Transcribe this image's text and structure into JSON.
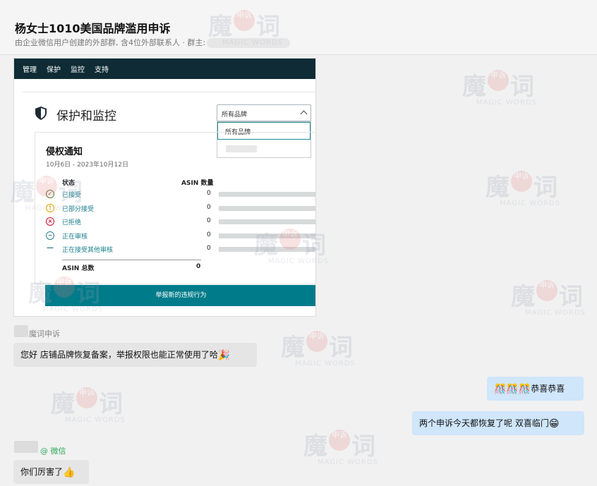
{
  "chat": {
    "title": "杨女士1010美国品牌滥用申诉",
    "subtitle": "由企业微信用户创建的外部群, 含4位外部联系人 · 群主:"
  },
  "screenshot": {
    "nav": [
      "管理",
      "保护",
      "监控",
      "支持"
    ],
    "heading": "保护和监控",
    "brand_select": "所有品牌",
    "brand_option": "所有品牌",
    "card_title": "侵权通知",
    "date_range": "10月6日 - 2023年10月12日",
    "col_status": "状态",
    "col_count": "ASIN 数量",
    "rows": [
      {
        "label": "已接受",
        "count": "0",
        "icon": "check-icon",
        "color": "#4f7a2a"
      },
      {
        "label": "已部分接受",
        "count": "0",
        "icon": "warning-icon",
        "color": "#e0a400"
      },
      {
        "label": "已拒绝",
        "count": "0",
        "icon": "x-circle-icon",
        "color": "#c8102e"
      },
      {
        "label": "正在审核",
        "count": "0",
        "icon": "minus-circle-icon",
        "color": "#2f7f8a"
      },
      {
        "label": "正在接受其他审核",
        "count": "0",
        "icon": "dash-icon",
        "color": "#2f7f8a"
      }
    ],
    "total_label": "ASIN 总数",
    "total_value": "0",
    "report_button": "举报新的违规行为"
  },
  "messages": [
    {
      "sender": "魔词申诉",
      "text": "您好 店铺品牌恢复备案，举报权限也能正常使用了哈",
      "emoji": "🎉"
    },
    {
      "text": "恭喜恭喜",
      "emoji": "🎊🎊🎊"
    },
    {
      "text": "两个申诉今天都恢复了呢  双喜临门",
      "emoji": "😁"
    },
    {
      "sender": "@ 微信",
      "text": "你们厉害了",
      "emoji": "👍"
    }
  ],
  "watermark": {
    "main": "魔",
    "seal": "申诉",
    "end": "词",
    "en": "MAGIC WORDS"
  }
}
